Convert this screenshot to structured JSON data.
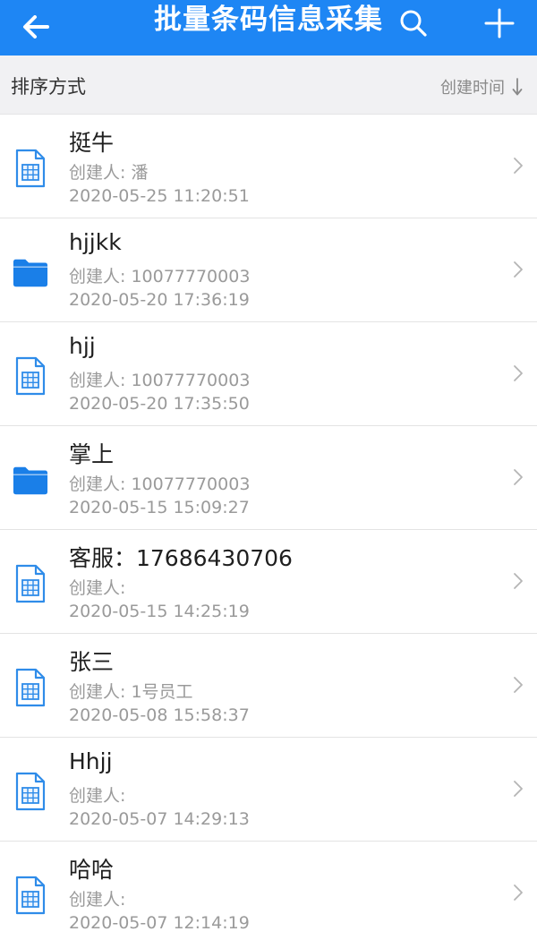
{
  "header": {
    "title": "批量条码信息采集",
    "back_icon": "back-arrow-icon",
    "search_icon": "search-icon",
    "add_icon": "plus-icon"
  },
  "sort": {
    "label": "排序方式",
    "value": "创建时间",
    "arrow_icon": "arrow-down-icon"
  },
  "colors": {
    "brand": "#1e86f4",
    "folder": "#1a7fe8",
    "doc_outline": "#2f8ce9",
    "text_secondary": "#9a9a9a"
  },
  "items": [
    {
      "name": "挺牛",
      "creator": "创建人: 潘",
      "date": "2020-05-25 11:20:51",
      "type": "document",
      "icon": "spreadsheet-file-icon"
    },
    {
      "name": "hjjkk",
      "creator": "创建人: 10077770003",
      "date": "2020-05-20 17:36:19",
      "type": "folder",
      "icon": "folder-icon"
    },
    {
      "name": "hjj",
      "creator": "创建人: 10077770003",
      "date": "2020-05-20 17:35:50",
      "type": "document",
      "icon": "spreadsheet-file-icon"
    },
    {
      "name": "掌上",
      "creator": "创建人: 10077770003",
      "date": "2020-05-15 15:09:27",
      "type": "folder",
      "icon": "folder-icon"
    },
    {
      "name": "客服：17686430706",
      "creator": "创建人:",
      "date": "2020-05-15 14:25:19",
      "type": "document",
      "icon": "spreadsheet-file-icon"
    },
    {
      "name": "张三",
      "creator": "创建人: 1号员工",
      "date": "2020-05-08 15:58:37",
      "type": "document",
      "icon": "spreadsheet-file-icon"
    },
    {
      "name": "Hhjj",
      "creator": "创建人:",
      "date": "2020-05-07 14:29:13",
      "type": "document",
      "icon": "spreadsheet-file-icon"
    },
    {
      "name": "哈哈",
      "creator": "创建人:",
      "date": "2020-05-07 12:14:19",
      "type": "document",
      "icon": "spreadsheet-file-icon"
    }
  ]
}
